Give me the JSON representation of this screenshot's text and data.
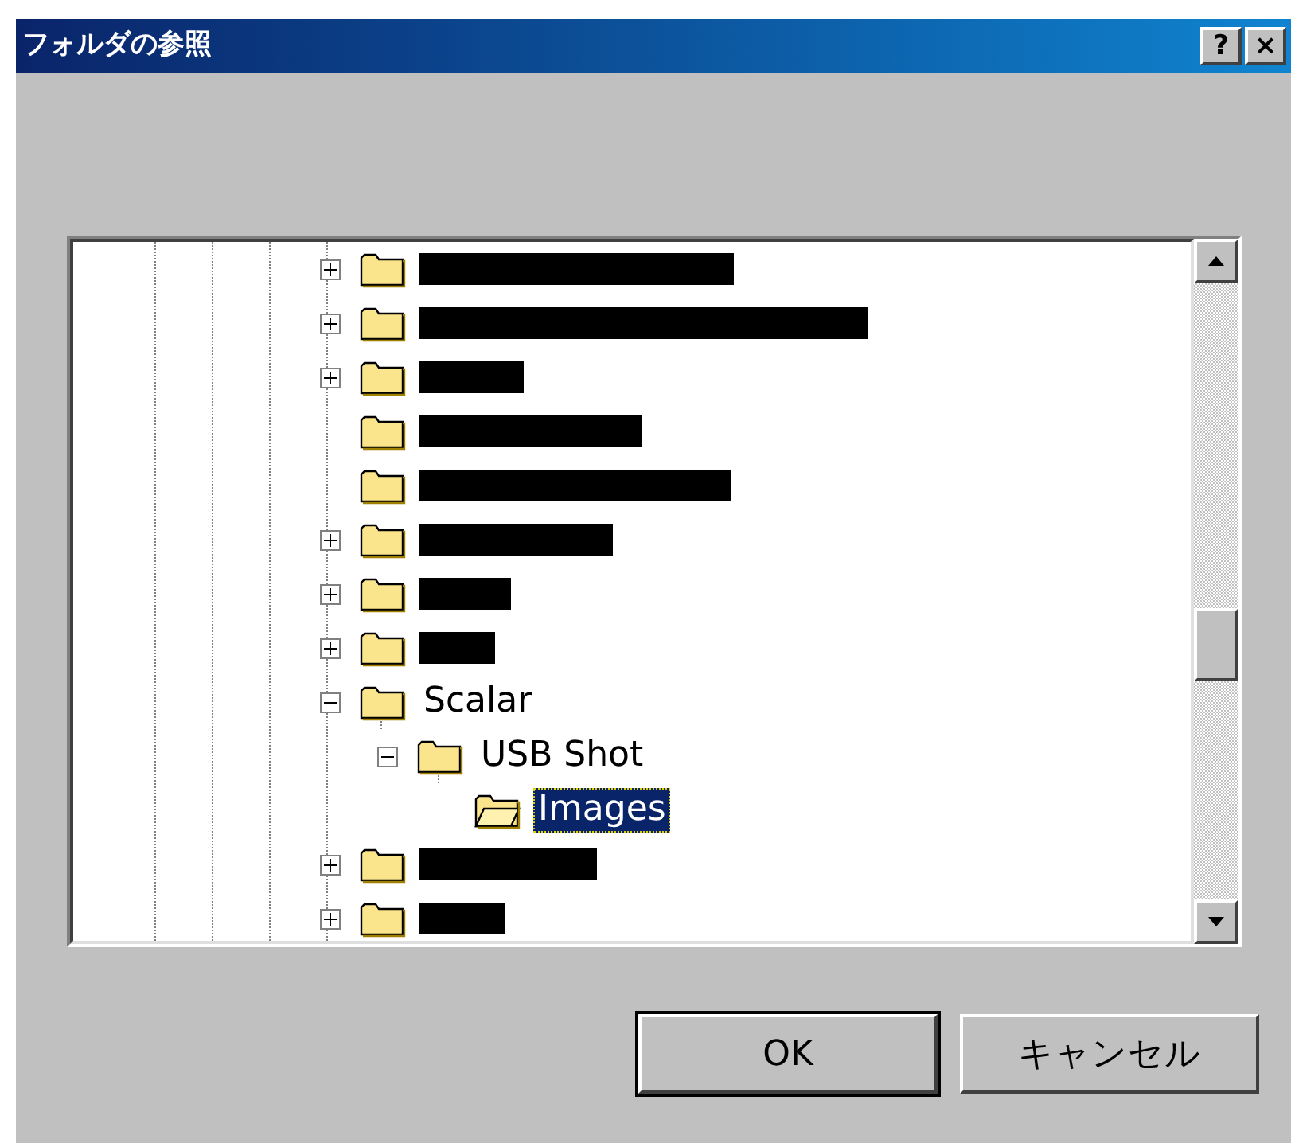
{
  "window": {
    "title": "フォルダの参照",
    "title_buttons": [
      "?",
      "×"
    ]
  },
  "tree": {
    "items": [
      {
        "kind": "redacted",
        "expandable": true,
        "expanded": false,
        "selected": false
      },
      {
        "kind": "redacted",
        "expandable": true,
        "expanded": false,
        "selected": false
      },
      {
        "kind": "redacted",
        "expandable": true,
        "expanded": false,
        "selected": false
      },
      {
        "kind": "redacted",
        "expandable": false,
        "selected": false
      },
      {
        "kind": "redacted",
        "expandable": false,
        "selected": false
      },
      {
        "kind": "redacted",
        "expandable": true,
        "expanded": false,
        "selected": false
      },
      {
        "kind": "redacted",
        "expandable": true,
        "expanded": false,
        "selected": false
      },
      {
        "kind": "redacted",
        "expandable": true,
        "expanded": false,
        "selected": false
      },
      {
        "kind": "folder",
        "label": "Scalar",
        "expandable": true,
        "expanded": true,
        "selected": false,
        "children": [
          {
            "kind": "folder",
            "label": "USB Shot",
            "expandable": true,
            "expanded": true,
            "selected": false,
            "children": [
              {
                "kind": "folder",
                "label": "Images",
                "expandable": false,
                "selected": true
              }
            ]
          }
        ]
      },
      {
        "kind": "redacted",
        "expandable": true,
        "expanded": false,
        "selected": false
      },
      {
        "kind": "redacted",
        "expandable": true,
        "expanded": false,
        "selected": false
      }
    ]
  },
  "buttons": [
    {
      "label": "OK",
      "default": true
    },
    {
      "label": "キャンセル",
      "default": false
    }
  ]
}
